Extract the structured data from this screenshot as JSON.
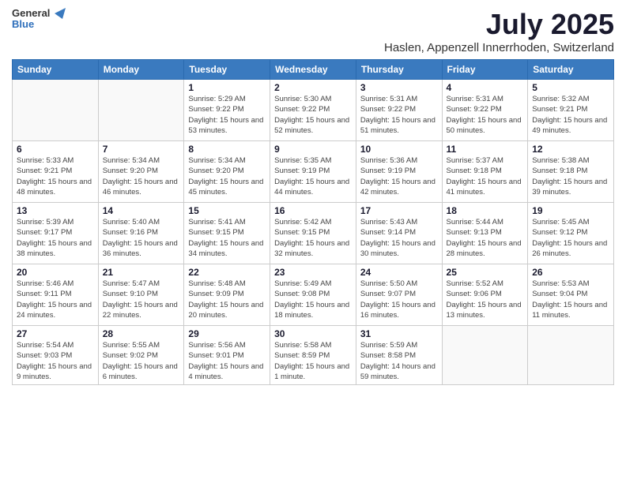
{
  "logo": {
    "text_general": "General",
    "text_blue": "Blue"
  },
  "header": {
    "title": "July 2025",
    "subtitle": "Haslen, Appenzell Innerrhoden, Switzerland"
  },
  "weekdays": [
    "Sunday",
    "Monday",
    "Tuesday",
    "Wednesday",
    "Thursday",
    "Friday",
    "Saturday"
  ],
  "weeks": [
    [
      {
        "day": "",
        "sunrise": "",
        "sunset": "",
        "daylight": ""
      },
      {
        "day": "",
        "sunrise": "",
        "sunset": "",
        "daylight": ""
      },
      {
        "day": "1",
        "sunrise": "Sunrise: 5:29 AM",
        "sunset": "Sunset: 9:22 PM",
        "daylight": "Daylight: 15 hours and 53 minutes."
      },
      {
        "day": "2",
        "sunrise": "Sunrise: 5:30 AM",
        "sunset": "Sunset: 9:22 PM",
        "daylight": "Daylight: 15 hours and 52 minutes."
      },
      {
        "day": "3",
        "sunrise": "Sunrise: 5:31 AM",
        "sunset": "Sunset: 9:22 PM",
        "daylight": "Daylight: 15 hours and 51 minutes."
      },
      {
        "day": "4",
        "sunrise": "Sunrise: 5:31 AM",
        "sunset": "Sunset: 9:22 PM",
        "daylight": "Daylight: 15 hours and 50 minutes."
      },
      {
        "day": "5",
        "sunrise": "Sunrise: 5:32 AM",
        "sunset": "Sunset: 9:21 PM",
        "daylight": "Daylight: 15 hours and 49 minutes."
      }
    ],
    [
      {
        "day": "6",
        "sunrise": "Sunrise: 5:33 AM",
        "sunset": "Sunset: 9:21 PM",
        "daylight": "Daylight: 15 hours and 48 minutes."
      },
      {
        "day": "7",
        "sunrise": "Sunrise: 5:34 AM",
        "sunset": "Sunset: 9:20 PM",
        "daylight": "Daylight: 15 hours and 46 minutes."
      },
      {
        "day": "8",
        "sunrise": "Sunrise: 5:34 AM",
        "sunset": "Sunset: 9:20 PM",
        "daylight": "Daylight: 15 hours and 45 minutes."
      },
      {
        "day": "9",
        "sunrise": "Sunrise: 5:35 AM",
        "sunset": "Sunset: 9:19 PM",
        "daylight": "Daylight: 15 hours and 44 minutes."
      },
      {
        "day": "10",
        "sunrise": "Sunrise: 5:36 AM",
        "sunset": "Sunset: 9:19 PM",
        "daylight": "Daylight: 15 hours and 42 minutes."
      },
      {
        "day": "11",
        "sunrise": "Sunrise: 5:37 AM",
        "sunset": "Sunset: 9:18 PM",
        "daylight": "Daylight: 15 hours and 41 minutes."
      },
      {
        "day": "12",
        "sunrise": "Sunrise: 5:38 AM",
        "sunset": "Sunset: 9:18 PM",
        "daylight": "Daylight: 15 hours and 39 minutes."
      }
    ],
    [
      {
        "day": "13",
        "sunrise": "Sunrise: 5:39 AM",
        "sunset": "Sunset: 9:17 PM",
        "daylight": "Daylight: 15 hours and 38 minutes."
      },
      {
        "day": "14",
        "sunrise": "Sunrise: 5:40 AM",
        "sunset": "Sunset: 9:16 PM",
        "daylight": "Daylight: 15 hours and 36 minutes."
      },
      {
        "day": "15",
        "sunrise": "Sunrise: 5:41 AM",
        "sunset": "Sunset: 9:15 PM",
        "daylight": "Daylight: 15 hours and 34 minutes."
      },
      {
        "day": "16",
        "sunrise": "Sunrise: 5:42 AM",
        "sunset": "Sunset: 9:15 PM",
        "daylight": "Daylight: 15 hours and 32 minutes."
      },
      {
        "day": "17",
        "sunrise": "Sunrise: 5:43 AM",
        "sunset": "Sunset: 9:14 PM",
        "daylight": "Daylight: 15 hours and 30 minutes."
      },
      {
        "day": "18",
        "sunrise": "Sunrise: 5:44 AM",
        "sunset": "Sunset: 9:13 PM",
        "daylight": "Daylight: 15 hours and 28 minutes."
      },
      {
        "day": "19",
        "sunrise": "Sunrise: 5:45 AM",
        "sunset": "Sunset: 9:12 PM",
        "daylight": "Daylight: 15 hours and 26 minutes."
      }
    ],
    [
      {
        "day": "20",
        "sunrise": "Sunrise: 5:46 AM",
        "sunset": "Sunset: 9:11 PM",
        "daylight": "Daylight: 15 hours and 24 minutes."
      },
      {
        "day": "21",
        "sunrise": "Sunrise: 5:47 AM",
        "sunset": "Sunset: 9:10 PM",
        "daylight": "Daylight: 15 hours and 22 minutes."
      },
      {
        "day": "22",
        "sunrise": "Sunrise: 5:48 AM",
        "sunset": "Sunset: 9:09 PM",
        "daylight": "Daylight: 15 hours and 20 minutes."
      },
      {
        "day": "23",
        "sunrise": "Sunrise: 5:49 AM",
        "sunset": "Sunset: 9:08 PM",
        "daylight": "Daylight: 15 hours and 18 minutes."
      },
      {
        "day": "24",
        "sunrise": "Sunrise: 5:50 AM",
        "sunset": "Sunset: 9:07 PM",
        "daylight": "Daylight: 15 hours and 16 minutes."
      },
      {
        "day": "25",
        "sunrise": "Sunrise: 5:52 AM",
        "sunset": "Sunset: 9:06 PM",
        "daylight": "Daylight: 15 hours and 13 minutes."
      },
      {
        "day": "26",
        "sunrise": "Sunrise: 5:53 AM",
        "sunset": "Sunset: 9:04 PM",
        "daylight": "Daylight: 15 hours and 11 minutes."
      }
    ],
    [
      {
        "day": "27",
        "sunrise": "Sunrise: 5:54 AM",
        "sunset": "Sunset: 9:03 PM",
        "daylight": "Daylight: 15 hours and 9 minutes."
      },
      {
        "day": "28",
        "sunrise": "Sunrise: 5:55 AM",
        "sunset": "Sunset: 9:02 PM",
        "daylight": "Daylight: 15 hours and 6 minutes."
      },
      {
        "day": "29",
        "sunrise": "Sunrise: 5:56 AM",
        "sunset": "Sunset: 9:01 PM",
        "daylight": "Daylight: 15 hours and 4 minutes."
      },
      {
        "day": "30",
        "sunrise": "Sunrise: 5:58 AM",
        "sunset": "Sunset: 8:59 PM",
        "daylight": "Daylight: 15 hours and 1 minute."
      },
      {
        "day": "31",
        "sunrise": "Sunrise: 5:59 AM",
        "sunset": "Sunset: 8:58 PM",
        "daylight": "Daylight: 14 hours and 59 minutes."
      },
      {
        "day": "",
        "sunrise": "",
        "sunset": "",
        "daylight": ""
      },
      {
        "day": "",
        "sunrise": "",
        "sunset": "",
        "daylight": ""
      }
    ]
  ]
}
